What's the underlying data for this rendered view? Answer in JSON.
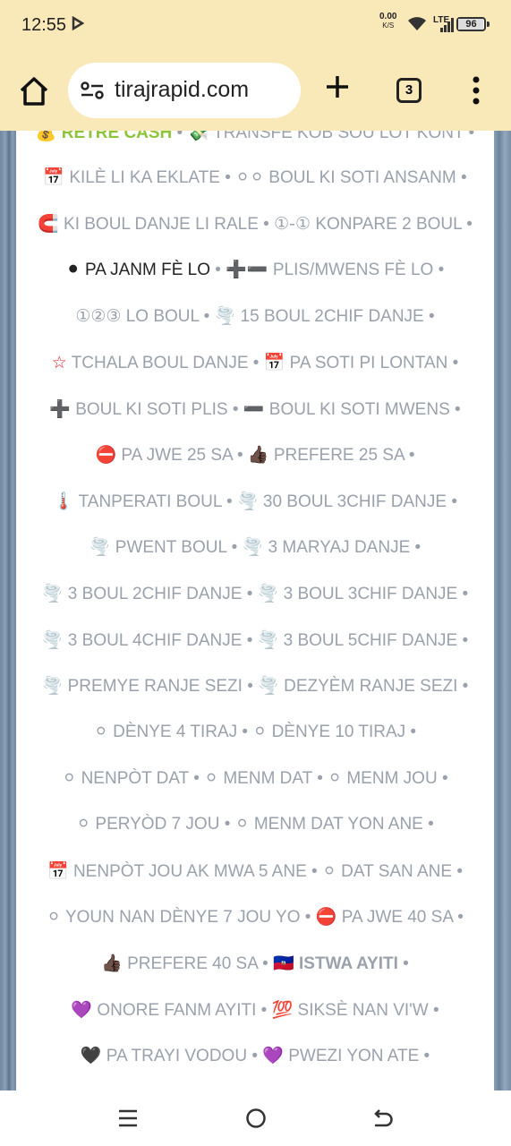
{
  "status": {
    "time": "12:55",
    "net_speed": "0.00",
    "net_unit": "K/S",
    "network": "LTE",
    "battery": "96",
    "battery_level": 0.96
  },
  "browser": {
    "url": "tirajrapid.com",
    "tab_count": "3"
  },
  "rows": [
    [
      {
        "e": "💰",
        "t": "RETRE CASH",
        "s": "green"
      },
      {
        "e": "💸",
        "t": "TRANSFE KOB SOU LOT KONT"
      }
    ],
    [
      {
        "e": "📅",
        "t": "KILÈ LI KA EKLATE"
      },
      {
        "e": "⚪⚪",
        "t": "BOUL KI SOTI ANSANM"
      }
    ],
    [
      {
        "e": "🧲",
        "t": "KI BOUL DANJE LI RALE"
      },
      {
        "e": "①-①",
        "t": "KONPARE 2 BOUL"
      }
    ],
    [
      {
        "e": "⚫",
        "t": "PA JANM FÈ LO",
        "s": "strong"
      },
      {
        "e": "➕➖",
        "t": "PLIS/MWENS FÈ LO"
      }
    ],
    [
      {
        "e": "①②③",
        "t": "LO BOUL"
      },
      {
        "e": "🌪️",
        "t": "15 BOUL 2CHIF DANJE"
      }
    ],
    [
      {
        "e": "☆",
        "t": "TCHALA BOUL DANJE",
        "ec": "#e0202a"
      },
      {
        "e": "📅",
        "t": "PA SOTI PI LONTAN"
      }
    ],
    [
      {
        "e": "➕",
        "t": "BOUL KI SOTI PLIS"
      },
      {
        "e": "➖",
        "t": "BOUL KI SOTI MWENS"
      }
    ],
    [
      {
        "e": "⛔",
        "t": "PA JWE 25 SA",
        "ec": "#e0202a"
      },
      {
        "e": "👍🏿",
        "t": "PREFERE 25 SA"
      }
    ],
    [
      {
        "e": "🌡️",
        "t": "TANPERATI BOUL",
        "ec": "#e0202a"
      },
      {
        "e": "🌪️",
        "t": "30 BOUL 3CHIF DANJE"
      }
    ],
    [
      {
        "e": "🌪️",
        "t": "PWENT BOUL"
      },
      {
        "e": "🌪️",
        "t": "3 MARYAJ DANJE"
      }
    ],
    [
      {
        "e": "🌪️",
        "t": "3 BOUL 2CHIF DANJE"
      },
      {
        "e": "🌪️",
        "t": "3 BOUL 3CHIF DANJE"
      }
    ],
    [
      {
        "e": "🌪️",
        "t": "3 BOUL 4CHIF DANJE"
      },
      {
        "e": "🌪️",
        "t": "3 BOUL 5CHIF DANJE"
      }
    ],
    [
      {
        "e": "🌪️",
        "t": "PREMYE RANJE SEZI"
      },
      {
        "e": "🌪️",
        "t": "DEZYÈM RANJE SEZI"
      }
    ],
    [
      {
        "e": "⚪",
        "t": "DÈNYE 4 TIRAJ"
      },
      {
        "e": "⚪",
        "t": "DÈNYE 10 TIRAJ"
      }
    ],
    [
      {
        "e": "⚪",
        "t": "NENPÒT DAT"
      },
      {
        "e": "⚪",
        "t": "MENM DAT"
      },
      {
        "e": "⚪",
        "t": "MENM JOU"
      }
    ],
    [
      {
        "e": "⚪",
        "t": "PERYÒD 7 JOU"
      },
      {
        "e": "⚪",
        "t": "MENM DAT YON ANE"
      }
    ],
    [
      {
        "e": "📅",
        "t": "NENPÒT JOU AK MWA 5 ANE"
      },
      {
        "e": "⚪",
        "t": "DAT SAN ANE"
      }
    ],
    [
      {
        "e": "⚪",
        "t": "YOUN NAN DÈNYE 7 JOU YO"
      },
      {
        "e": "⛔",
        "t": "PA JWE 40 SA",
        "ec": "#e0202a"
      }
    ],
    [
      {
        "e": "👍🏿",
        "t": "PREFERE 40 SA"
      },
      {
        "e": "🇭🇹",
        "t": "ISTWA AYITI",
        "s": "bold"
      }
    ],
    [
      {
        "e": "💜",
        "t": "ONORE FANM AYITI",
        "ec": "#8e44ad"
      },
      {
        "e": "💯",
        "t": "SIKSÈ NAN VI'W",
        "ec": "#e0202a"
      }
    ],
    [
      {
        "e": "🖤",
        "t": "PA TRAYI VODOU"
      },
      {
        "e": "💜",
        "t": "PWEZI YON ATE",
        "ec": "#8e44ad"
      }
    ]
  ],
  "colors": {
    "status_bg": "#f9e8b8",
    "link_gray": "#9aa1ab",
    "green": "#8cc43b"
  }
}
